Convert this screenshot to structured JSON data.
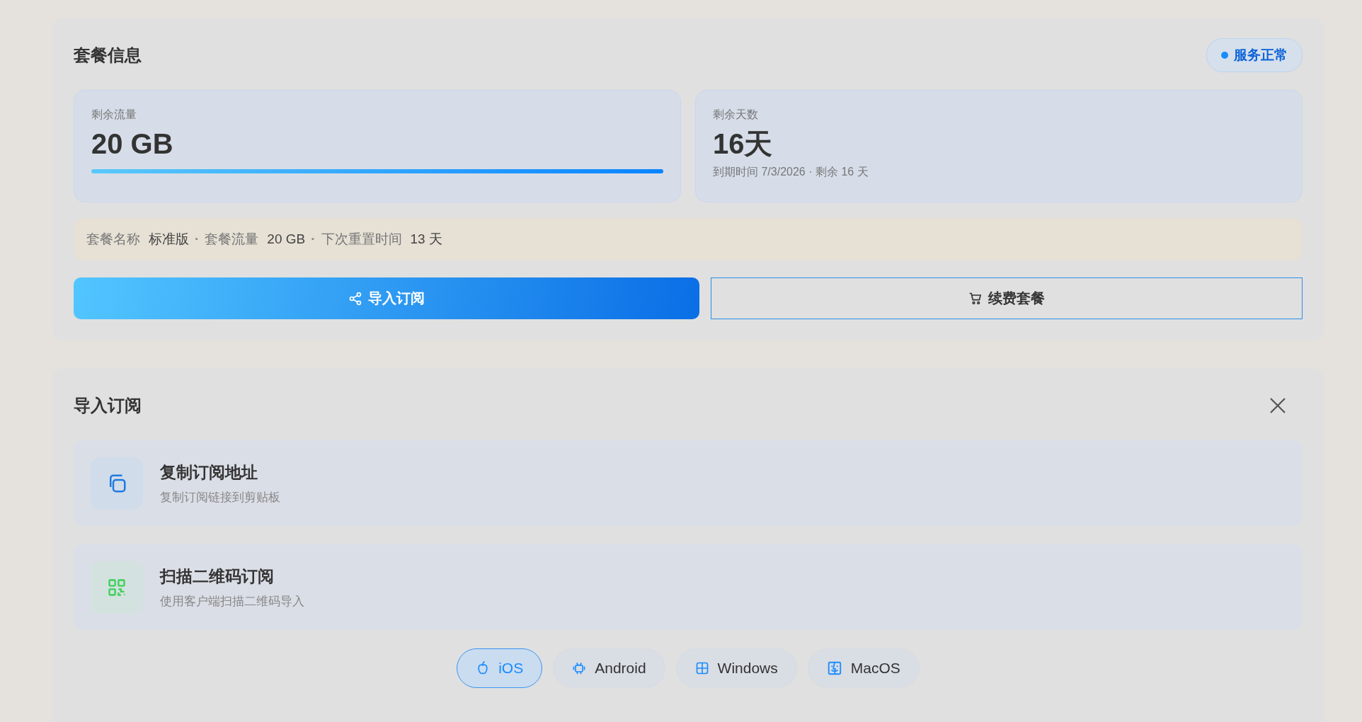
{
  "plan_card": {
    "title": "套餐信息",
    "status": {
      "label": "服务正常",
      "ok": true
    },
    "stats": [
      {
        "kind": "traffic",
        "label": "剩余流量",
        "value": "20 GB",
        "level": 1.0
      },
      {
        "kind": "days",
        "label": "剩余天数",
        "value": "16天",
        "note": "到期时间 7/3/2026 · 剩余 16 天"
      }
    ],
    "details": [
      {
        "label": "套餐名称",
        "value": "标准版",
        "separator": "·"
      },
      {
        "label": "套餐流量",
        "value": "20 GB",
        "separator": "·"
      },
      {
        "label": "下次重置时间",
        "value": "13 天"
      }
    ],
    "actions": [
      {
        "kind": "primary",
        "label": "导入订阅"
      },
      {
        "kind": "outline",
        "label": "续费套餐"
      }
    ]
  },
  "import_card": {
    "title": "导入订阅",
    "options": [
      {
        "title": "复制订阅地址",
        "subtitle": "复制订阅链接到剪贴板"
      },
      {
        "title": "扫描二维码订阅",
        "subtitle": "使用客户端扫描二维码导入"
      }
    ],
    "platforms": [
      {
        "label": "iOS",
        "selected": true
      },
      {
        "label": "Android",
        "selected": false
      },
      {
        "label": "Windows",
        "selected": false
      },
      {
        "label": "MacOS",
        "selected": false
      }
    ]
  }
}
